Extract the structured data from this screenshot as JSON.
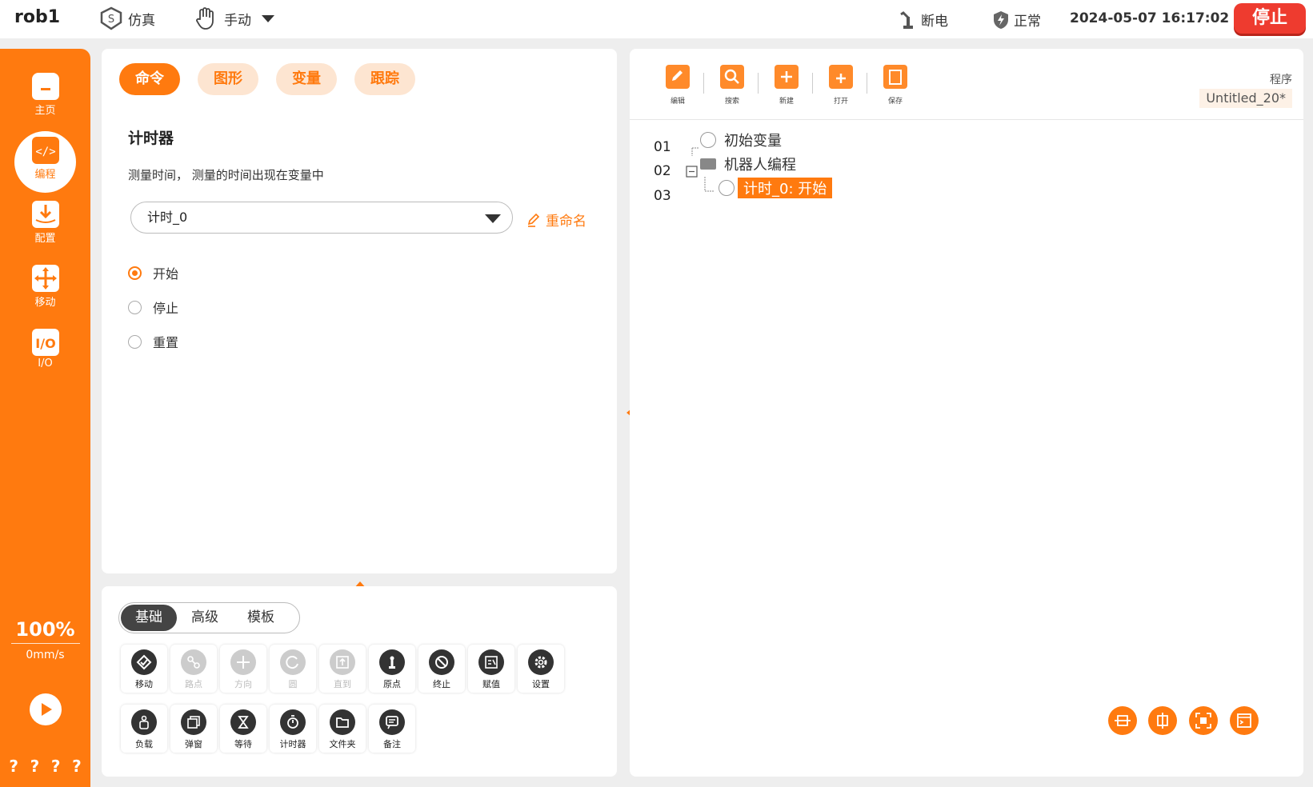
{
  "topbar": {
    "robot": "rob1",
    "sim": "仿真",
    "mode": "手动",
    "power": "断电",
    "status": "正常",
    "datetime": "2024-05-07 16:17:02",
    "stop": "停止"
  },
  "sidebar": {
    "items": [
      {
        "label": "主页"
      },
      {
        "label": "编程"
      },
      {
        "label": "配置"
      },
      {
        "label": "移动"
      },
      {
        "label": "I/O"
      }
    ],
    "speed_percent": "100%",
    "speed_mms": "0mm/s",
    "qmarks": [
      "?",
      "?",
      "?",
      "?"
    ]
  },
  "cmd_panel": {
    "tabs": [
      "命令",
      "图形",
      "变量",
      "跟踪"
    ],
    "title": "计时器",
    "desc": "测量时间， 测量的时间出现在变量中",
    "select_value": "计时_0",
    "rename": "重命名",
    "radios": [
      "开始",
      "停止",
      "重置"
    ]
  },
  "tools_panel": {
    "seg": [
      "基础",
      "高级",
      "模板"
    ],
    "row1": [
      "移动",
      "路点",
      "方向",
      "圆",
      "直到",
      "原点",
      "终止",
      "赋值",
      "设置"
    ],
    "row2": [
      "负载",
      "弹窗",
      "等待",
      "计时器",
      "文件夹",
      "备注"
    ]
  },
  "program_panel": {
    "toolbar": [
      "编辑",
      "搜索",
      "新建",
      "打开",
      "保存"
    ],
    "prog_label": "程序",
    "prog_name": "Untitled_20*",
    "lines": [
      "01",
      "02",
      "03"
    ],
    "nodes": [
      "初始变量",
      "机器人编程",
      "计时_0: 开始"
    ]
  },
  "colors": {
    "accent": "#ff7a0f",
    "stop": "#ee3b2f"
  }
}
